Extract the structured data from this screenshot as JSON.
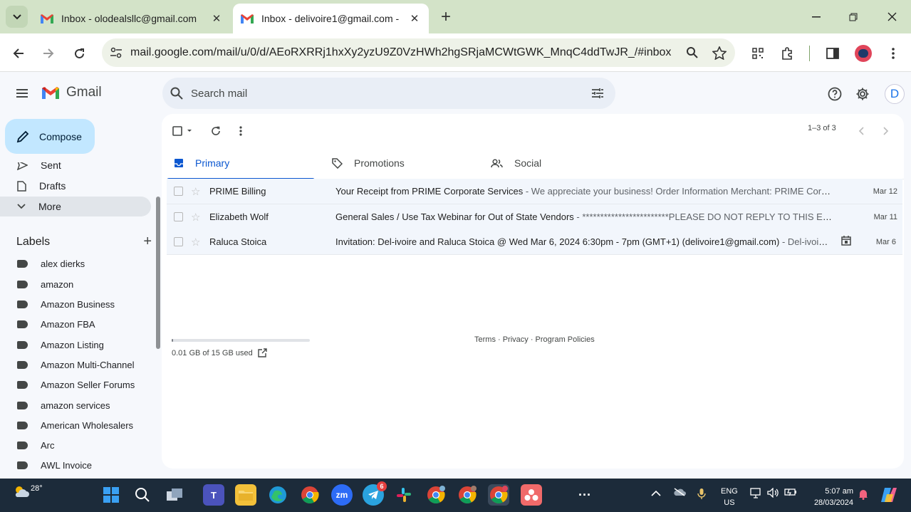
{
  "browser": {
    "tabs": [
      {
        "title": "Inbox - olodealsllc@gmail.com",
        "active": false
      },
      {
        "title": "Inbox - delivoire1@gmail.com -",
        "active": true
      }
    ],
    "url": "mail.google.com/mail/u/0/d/AEoRXRRj1hxXy2yzU9Z0VzHWh2hgSRjaMCWtGWK_MnqC4ddTwJR_/#inbox"
  },
  "gmail": {
    "logo_text": "Gmail",
    "search_placeholder": "Search mail",
    "avatar_letter": "D",
    "compose_label": "Compose"
  },
  "sidebar": {
    "nav": [
      {
        "label": "Sent",
        "icon": "send-icon"
      },
      {
        "label": "Drafts",
        "icon": "draft-icon"
      },
      {
        "label": "More",
        "icon": "chevron-down-icon"
      }
    ],
    "labels_heading": "Labels",
    "labels": [
      "alex dierks",
      "amazon",
      "Amazon Business",
      "Amazon FBA",
      "Amazon Listing",
      "Amazon Multi-Channel",
      "Amazon Seller Forums",
      "amazon services",
      "American Wholesalers",
      "Arc",
      "AWL Invoice"
    ]
  },
  "mail": {
    "pager": "1–3 of 3",
    "tabs": [
      {
        "label": "Primary",
        "icon": "inbox-icon",
        "active": true
      },
      {
        "label": "Promotions",
        "icon": "tag-icon",
        "active": false
      },
      {
        "label": "Social",
        "icon": "people-icon",
        "active": false
      }
    ],
    "rows": [
      {
        "sender": "PRIME Billing",
        "subject": "Your Receipt from PRIME Corporate Services",
        "snippet": " - We appreciate your business! Order Information Merchant: PRIME Corporate...",
        "date": "Mar 12",
        "calendar": false
      },
      {
        "sender": "Elizabeth Wolf",
        "subject": "General Sales / Use Tax Webinar for Out of State Vendors",
        "snippet": " - ************************PLEASE DO NOT REPLY TO THIS EMAIL*...",
        "date": "Mar 11",
        "calendar": false
      },
      {
        "sender": "Raluca Stoica",
        "subject": "Invitation: Del-ivoire and Raluca Stoica @ Wed Mar 6, 2024 6:30pm - 7pm (GMT+1) (delivoire1@gmail.com)",
        "snippet": " - Del-ivoire and ...",
        "date": "Mar 6",
        "calendar": true
      }
    ],
    "storage_text": "0.01 GB of 15 GB used",
    "storage_fraction": 0.001,
    "footer": "Terms · Privacy · Program Policies"
  },
  "taskbar": {
    "temperature": "28°",
    "telegram_badge": "6",
    "zoom_label": "zm",
    "lang_line1": "ENG",
    "lang_line2": "US",
    "time": "5:07 am",
    "date": "28/03/2024"
  }
}
